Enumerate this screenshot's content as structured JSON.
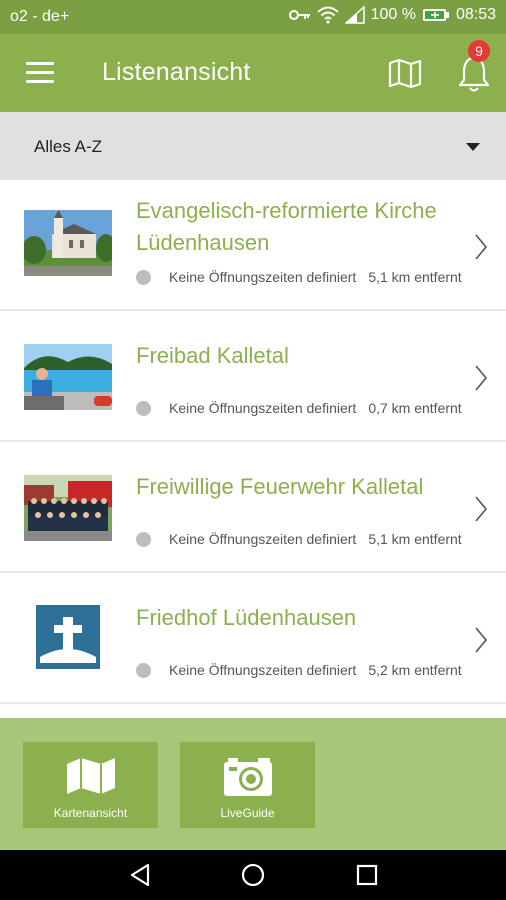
{
  "status_bar": {
    "carrier": "o2 - de+",
    "battery": "100 %",
    "time": "08:53",
    "icons": [
      "key-icon",
      "wifi-icon",
      "signal-icon",
      "battery-icon"
    ]
  },
  "app_bar": {
    "title": "Listenansicht",
    "menu_icon": "hamburger-menu-icon",
    "map_icon": "map-icon",
    "bell_icon": "bell-icon",
    "notification_count": "9"
  },
  "filter": {
    "label": "Alles A-Z",
    "icon": "caret-down-icon"
  },
  "list": {
    "items": [
      {
        "title": "Evangelisch-reformierte Kirche Lüdenhausen",
        "status": "Keine Öffnungszeiten definiert",
        "distance": "5,1 km entfernt",
        "thumb": "church-photo"
      },
      {
        "title": "Freibad Kalletal",
        "status": "Keine Öffnungszeiten definiert",
        "distance": "0,7 km entfernt",
        "thumb": "pool-photo"
      },
      {
        "title": "Freiwillige Feuerwehr Kalletal",
        "status": "Keine Öffnungszeiten definiert",
        "distance": "5,1 km entfernt",
        "thumb": "firefighters-photo"
      },
      {
        "title": "Friedhof Lüdenhausen",
        "status": "Keine Öffnungszeiten definiert",
        "distance": "5,2 km entfernt",
        "thumb": "cemetery-icon"
      }
    ]
  },
  "bottom": {
    "tiles": [
      {
        "label": "Kartenansicht",
        "icon": "map-icon"
      },
      {
        "label": "LiveGuide",
        "icon": "camera-icon"
      }
    ]
  },
  "colors": {
    "primary": "#8cb04d",
    "status_bar": "#7ba044",
    "bottom_panel": "#a7c67a",
    "badge": "#e53935",
    "cemetery_blue": "#2e6f96"
  }
}
